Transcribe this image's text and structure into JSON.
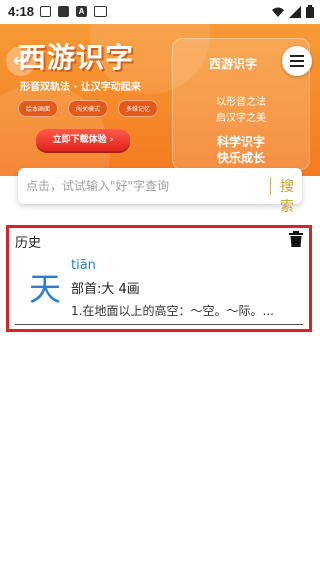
{
  "status_bar": {
    "time": "4:18"
  },
  "banner": {
    "title": "西游识字",
    "subtitle": "形音双轨法 · 让汉字动起来",
    "pills": [
      "绘本画面",
      "闯关模式",
      "多维记忆"
    ],
    "download_label": "立即下载体验 ›",
    "panel": {
      "title": "西游识字",
      "line1": "以形音之法",
      "line2": "启汉字之美",
      "line3": "科学识字",
      "line4": "快乐成长"
    }
  },
  "search": {
    "placeholder": "点击，试试输入\"好\"字查询",
    "button_label": "搜索"
  },
  "history": {
    "title": "历史",
    "items": [
      {
        "char": "天",
        "pinyin": "tiān",
        "radical": "部首:大   4画",
        "definition": "1.在地面以上的高空：～空。～际。..."
      }
    ]
  },
  "colors": {
    "banner_orange": "#f58a2a",
    "accent_blue": "#2a7fd4",
    "search_gold": "#c9a227",
    "highlight_red": "#d8212b"
  }
}
